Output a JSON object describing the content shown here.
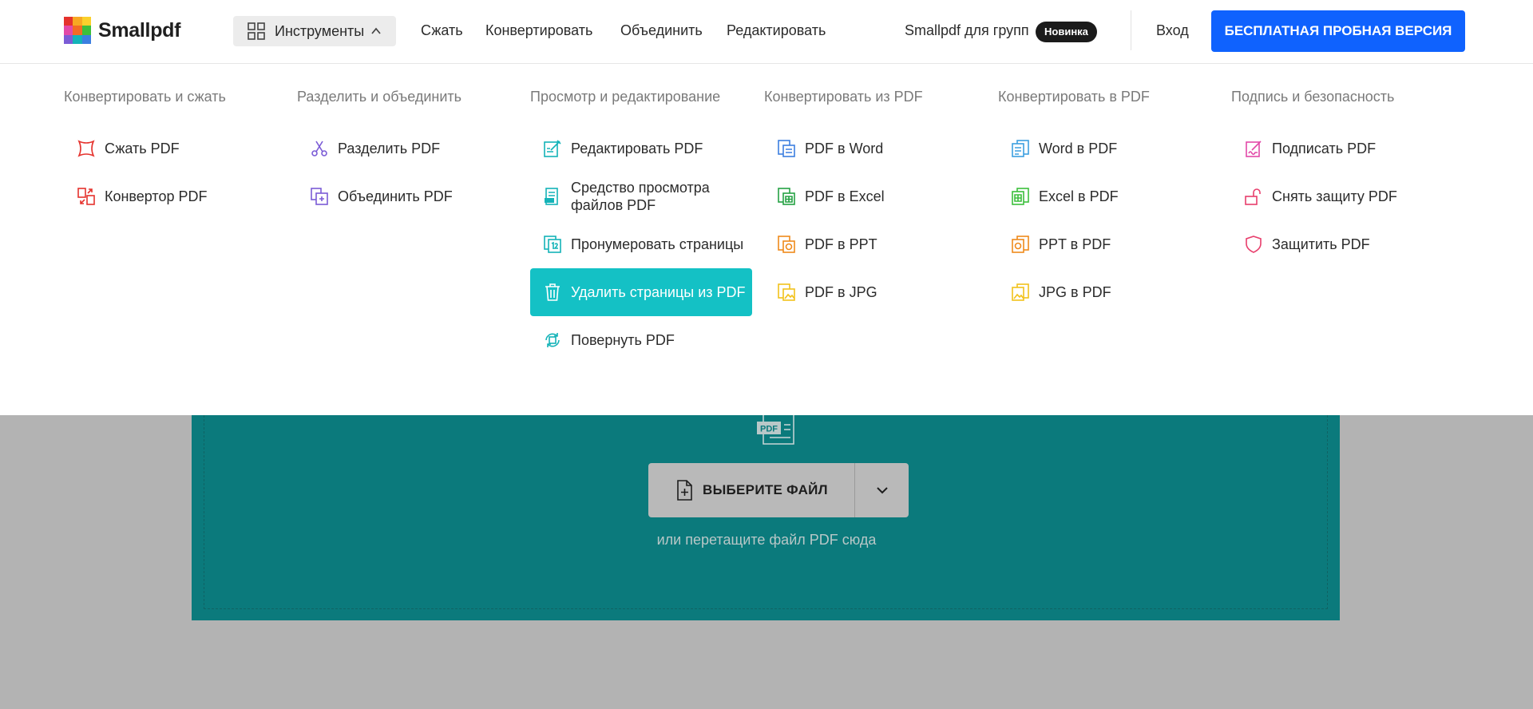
{
  "header": {
    "logo_text": "Smallpdf",
    "tools_label": "Инструменты",
    "nav": [
      "Сжать",
      "Конвертировать",
      "Объединить",
      "Редактировать"
    ],
    "teams_label": "Smallpdf для групп",
    "badge": "Новинка",
    "login": "Вход",
    "trial_button": "БЕСПЛАТНАЯ ПРОБНАЯ ВЕРСИЯ"
  },
  "menu": {
    "columns": [
      {
        "title": "Конвертировать и сжать",
        "items": [
          {
            "label": "Сжать PDF",
            "icon": "compress-icon",
            "color": "#e5322d"
          },
          {
            "label": "Конвертор PDF",
            "icon": "convert-icon",
            "color": "#e5322d"
          }
        ]
      },
      {
        "title": "Разделить и объединить",
        "items": [
          {
            "label": "Разделить PDF",
            "icon": "scissors-icon",
            "color": "#7b5cd6"
          },
          {
            "label": "Объединить PDF",
            "icon": "merge-icon",
            "color": "#7b5cd6"
          }
        ]
      },
      {
        "title": "Просмотр и редактирование",
        "items": [
          {
            "label": "Редактировать PDF",
            "icon": "edit-icon",
            "color": "#14b3b8"
          },
          {
            "label": "Средство просмотра файлов PDF",
            "icon": "viewer-icon",
            "color": "#14b3b8"
          },
          {
            "label": "Пронумеровать страницы",
            "icon": "page-numbers-icon",
            "color": "#14b3b8"
          },
          {
            "label": "Удалить страницы из PDF",
            "icon": "trash-icon",
            "color": "#ffffff",
            "active": true
          },
          {
            "label": "Повернуть PDF",
            "icon": "rotate-icon",
            "color": "#14b3b8"
          }
        ]
      },
      {
        "title": "Конвертировать из PDF",
        "items": [
          {
            "label": "PDF в Word",
            "icon": "pdf-to-word-icon",
            "color": "#3c7fe0"
          },
          {
            "label": "PDF в Excel",
            "icon": "pdf-to-excel-icon",
            "color": "#25a244"
          },
          {
            "label": "PDF в PPT",
            "icon": "pdf-to-ppt-icon",
            "color": "#ef8a1c"
          },
          {
            "label": "PDF в JPG",
            "icon": "pdf-to-jpg-icon",
            "color": "#f2c21b"
          }
        ]
      },
      {
        "title": "Конвертировать в PDF",
        "items": [
          {
            "label": "Word в PDF",
            "icon": "word-to-pdf-icon",
            "color": "#3c9fe0"
          },
          {
            "label": "Excel в PDF",
            "icon": "excel-to-pdf-icon",
            "color": "#3cbf3c"
          },
          {
            "label": "PPT в PDF",
            "icon": "ppt-to-pdf-icon",
            "color": "#ef8a1c"
          },
          {
            "label": "JPG в PDF",
            "icon": "jpg-to-pdf-icon",
            "color": "#f2c21b"
          }
        ]
      },
      {
        "title": "Подпись и безопасность",
        "items": [
          {
            "label": "Подписать PDF",
            "icon": "sign-icon",
            "color": "#e249a8"
          },
          {
            "label": "Снять защиту PDF",
            "icon": "unlock-icon",
            "color": "#e83e6c"
          },
          {
            "label": "Защитить PDF",
            "icon": "shield-icon",
            "color": "#e83e6c"
          }
        ]
      }
    ]
  },
  "upload": {
    "file_icon_label": "PDF",
    "choose_button": "ВЫБЕРИТЕ ФАЙЛ",
    "drop_hint": "или перетащите файл PDF сюда"
  },
  "colors": {
    "accent_blue": "#0f62fe",
    "active_item": "#14c1c5",
    "upload_bg": "#0b7a7c",
    "overlay": "#b3b3b3"
  }
}
